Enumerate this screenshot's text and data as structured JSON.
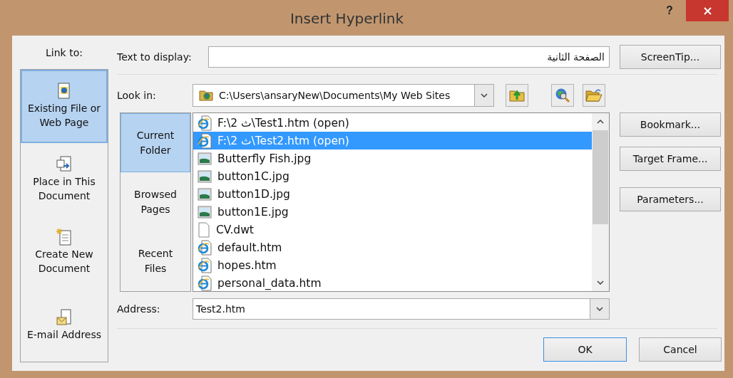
{
  "window": {
    "title": "Insert Hyperlink",
    "help": "?"
  },
  "link_to": {
    "label": "Link to:",
    "items": [
      {
        "label": "Existing File or Web Page",
        "kind": "file",
        "selected": true
      },
      {
        "label": "Place in This Document",
        "kind": "place",
        "selected": false
      },
      {
        "label": "Create New Document",
        "kind": "new",
        "selected": false
      },
      {
        "label": "E-mail Address",
        "kind": "email",
        "selected": false
      }
    ]
  },
  "text_to_display": {
    "label": "Text to display:",
    "value": "الصفحة الثانية"
  },
  "screentip_button": "ScreenTip...",
  "look_in": {
    "label": "Look in:",
    "value": "C:\\Users\\ansaryNew\\Documents\\My Web Sites"
  },
  "view_tabs": [
    {
      "label": "Current Folder",
      "selected": true
    },
    {
      "label": "Browsed Pages",
      "selected": false
    },
    {
      "label": "Recent Files",
      "selected": false
    }
  ],
  "files": [
    {
      "name": "F:\\2 ث\\Test1.htm (open)",
      "kind": "web",
      "selected": false
    },
    {
      "name": "F:\\2 ث\\Test2.htm (open)",
      "kind": "web",
      "selected": true
    },
    {
      "name": "Butterfly Fish.jpg",
      "kind": "image",
      "selected": false
    },
    {
      "name": "button1C.jpg",
      "kind": "image",
      "selected": false
    },
    {
      "name": "button1D.jpg",
      "kind": "image",
      "selected": false
    },
    {
      "name": "button1E.jpg",
      "kind": "image",
      "selected": false
    },
    {
      "name": "CV.dwt",
      "kind": "blank",
      "selected": false
    },
    {
      "name": "default.htm",
      "kind": "web",
      "selected": false
    },
    {
      "name": "hopes.htm",
      "kind": "web",
      "selected": false
    },
    {
      "name": "personal_data.htm",
      "kind": "web",
      "selected": false
    }
  ],
  "side_buttons": [
    "Bookmark...",
    "Target Frame...",
    "Parameters..."
  ],
  "address": {
    "label": "Address:",
    "value": "Test2.htm"
  },
  "buttons": [
    {
      "label": "OK",
      "default": true
    },
    {
      "label": "Cancel",
      "default": false
    }
  ]
}
